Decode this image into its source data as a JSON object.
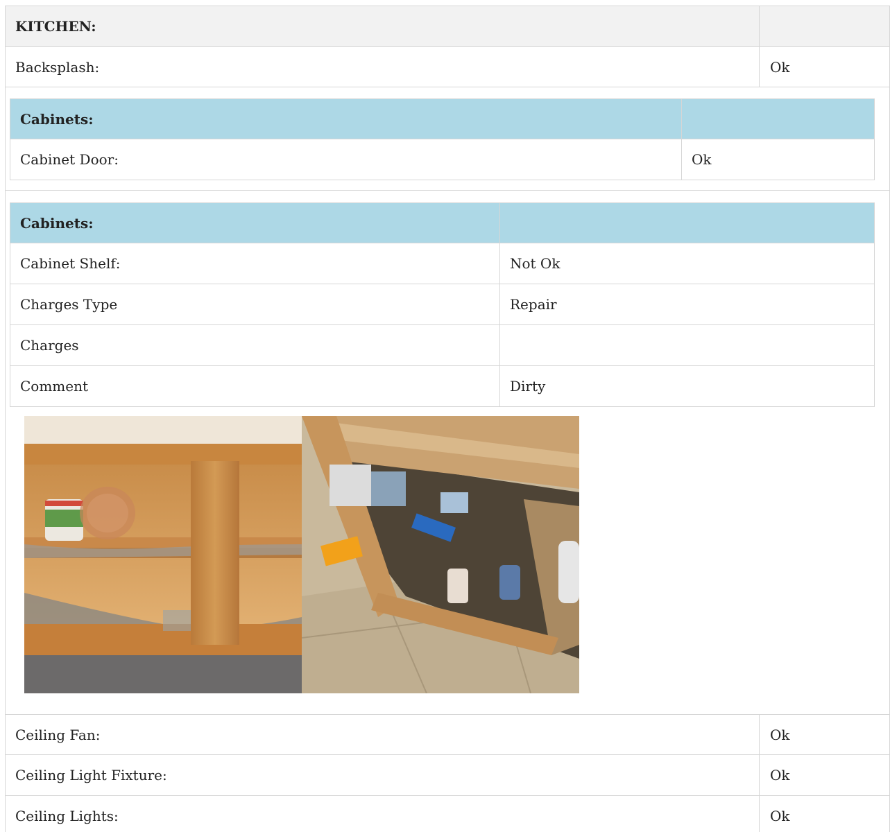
{
  "section_title": "KITCHEN:",
  "rows_top": [
    {
      "label": "Backsplash:",
      "value": "Ok"
    }
  ],
  "cabinets_door": {
    "title": "Cabinets:",
    "rows": [
      {
        "label": "Cabinet Door:",
        "value": "Ok"
      }
    ]
  },
  "cabinets_shelf": {
    "title": "Cabinets:",
    "rows": [
      {
        "label": "Cabinet Shelf:",
        "value": "Not Ok"
      },
      {
        "label": "Charges Type",
        "value": "Repair"
      },
      {
        "label": "Charges",
        "value": ""
      },
      {
        "label": "Comment",
        "value": "Dirty"
      }
    ]
  },
  "rows_bottom": [
    {
      "label": "Ceiling Fan:",
      "value": "Ok"
    },
    {
      "label": "Ceiling Light Fixture:",
      "value": "Ok"
    },
    {
      "label": "Ceiling Lights:",
      "value": "Ok"
    }
  ]
}
